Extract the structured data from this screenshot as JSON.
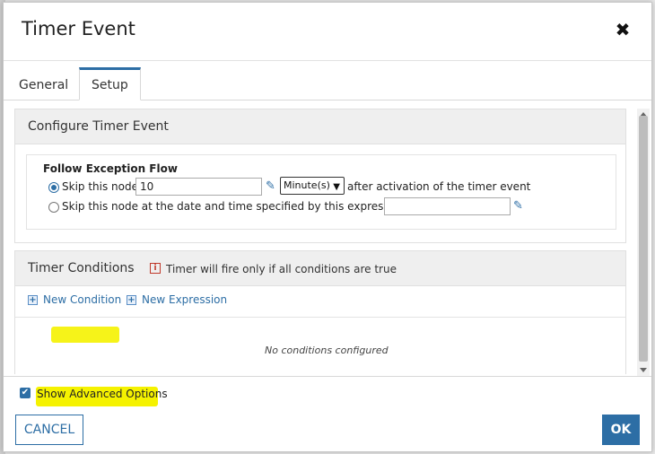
{
  "dialog": {
    "title": "Timer Event",
    "close_glyph": "✖"
  },
  "tabs": [
    {
      "label": "General",
      "active": false
    },
    {
      "label": "Setup",
      "active": true
    }
  ],
  "configure_panel": {
    "title": "Configure Timer Event",
    "follow_exception_flow": "Follow Exception Flow",
    "option1": {
      "label": "Skip this node",
      "value": "10",
      "unit": "Minute(s)",
      "suffix": "after activation of the timer event",
      "selected": true
    },
    "option2": {
      "label": "Skip this node at the date and time specified by this expression:",
      "value": "",
      "selected": false
    }
  },
  "conditions_panel": {
    "title": "Timer Conditions",
    "warning_icon": "i",
    "warning": "Timer will fire only if all conditions are true",
    "new_condition": "New Condition",
    "new_expression": "New Expression",
    "empty_text": "No conditions configured"
  },
  "footer": {
    "show_advanced": "Show Advanced Options",
    "show_advanced_checked": true,
    "cancel": "CANCEL",
    "ok": "OK"
  },
  "colors": {
    "accent": "#2d6ea5",
    "highlight": "#f5f200"
  },
  "icons": {
    "edit": "edit-icon",
    "plus": "plus-icon",
    "info": "info-icon",
    "close": "close-icon",
    "checkbox": "check-icon"
  }
}
